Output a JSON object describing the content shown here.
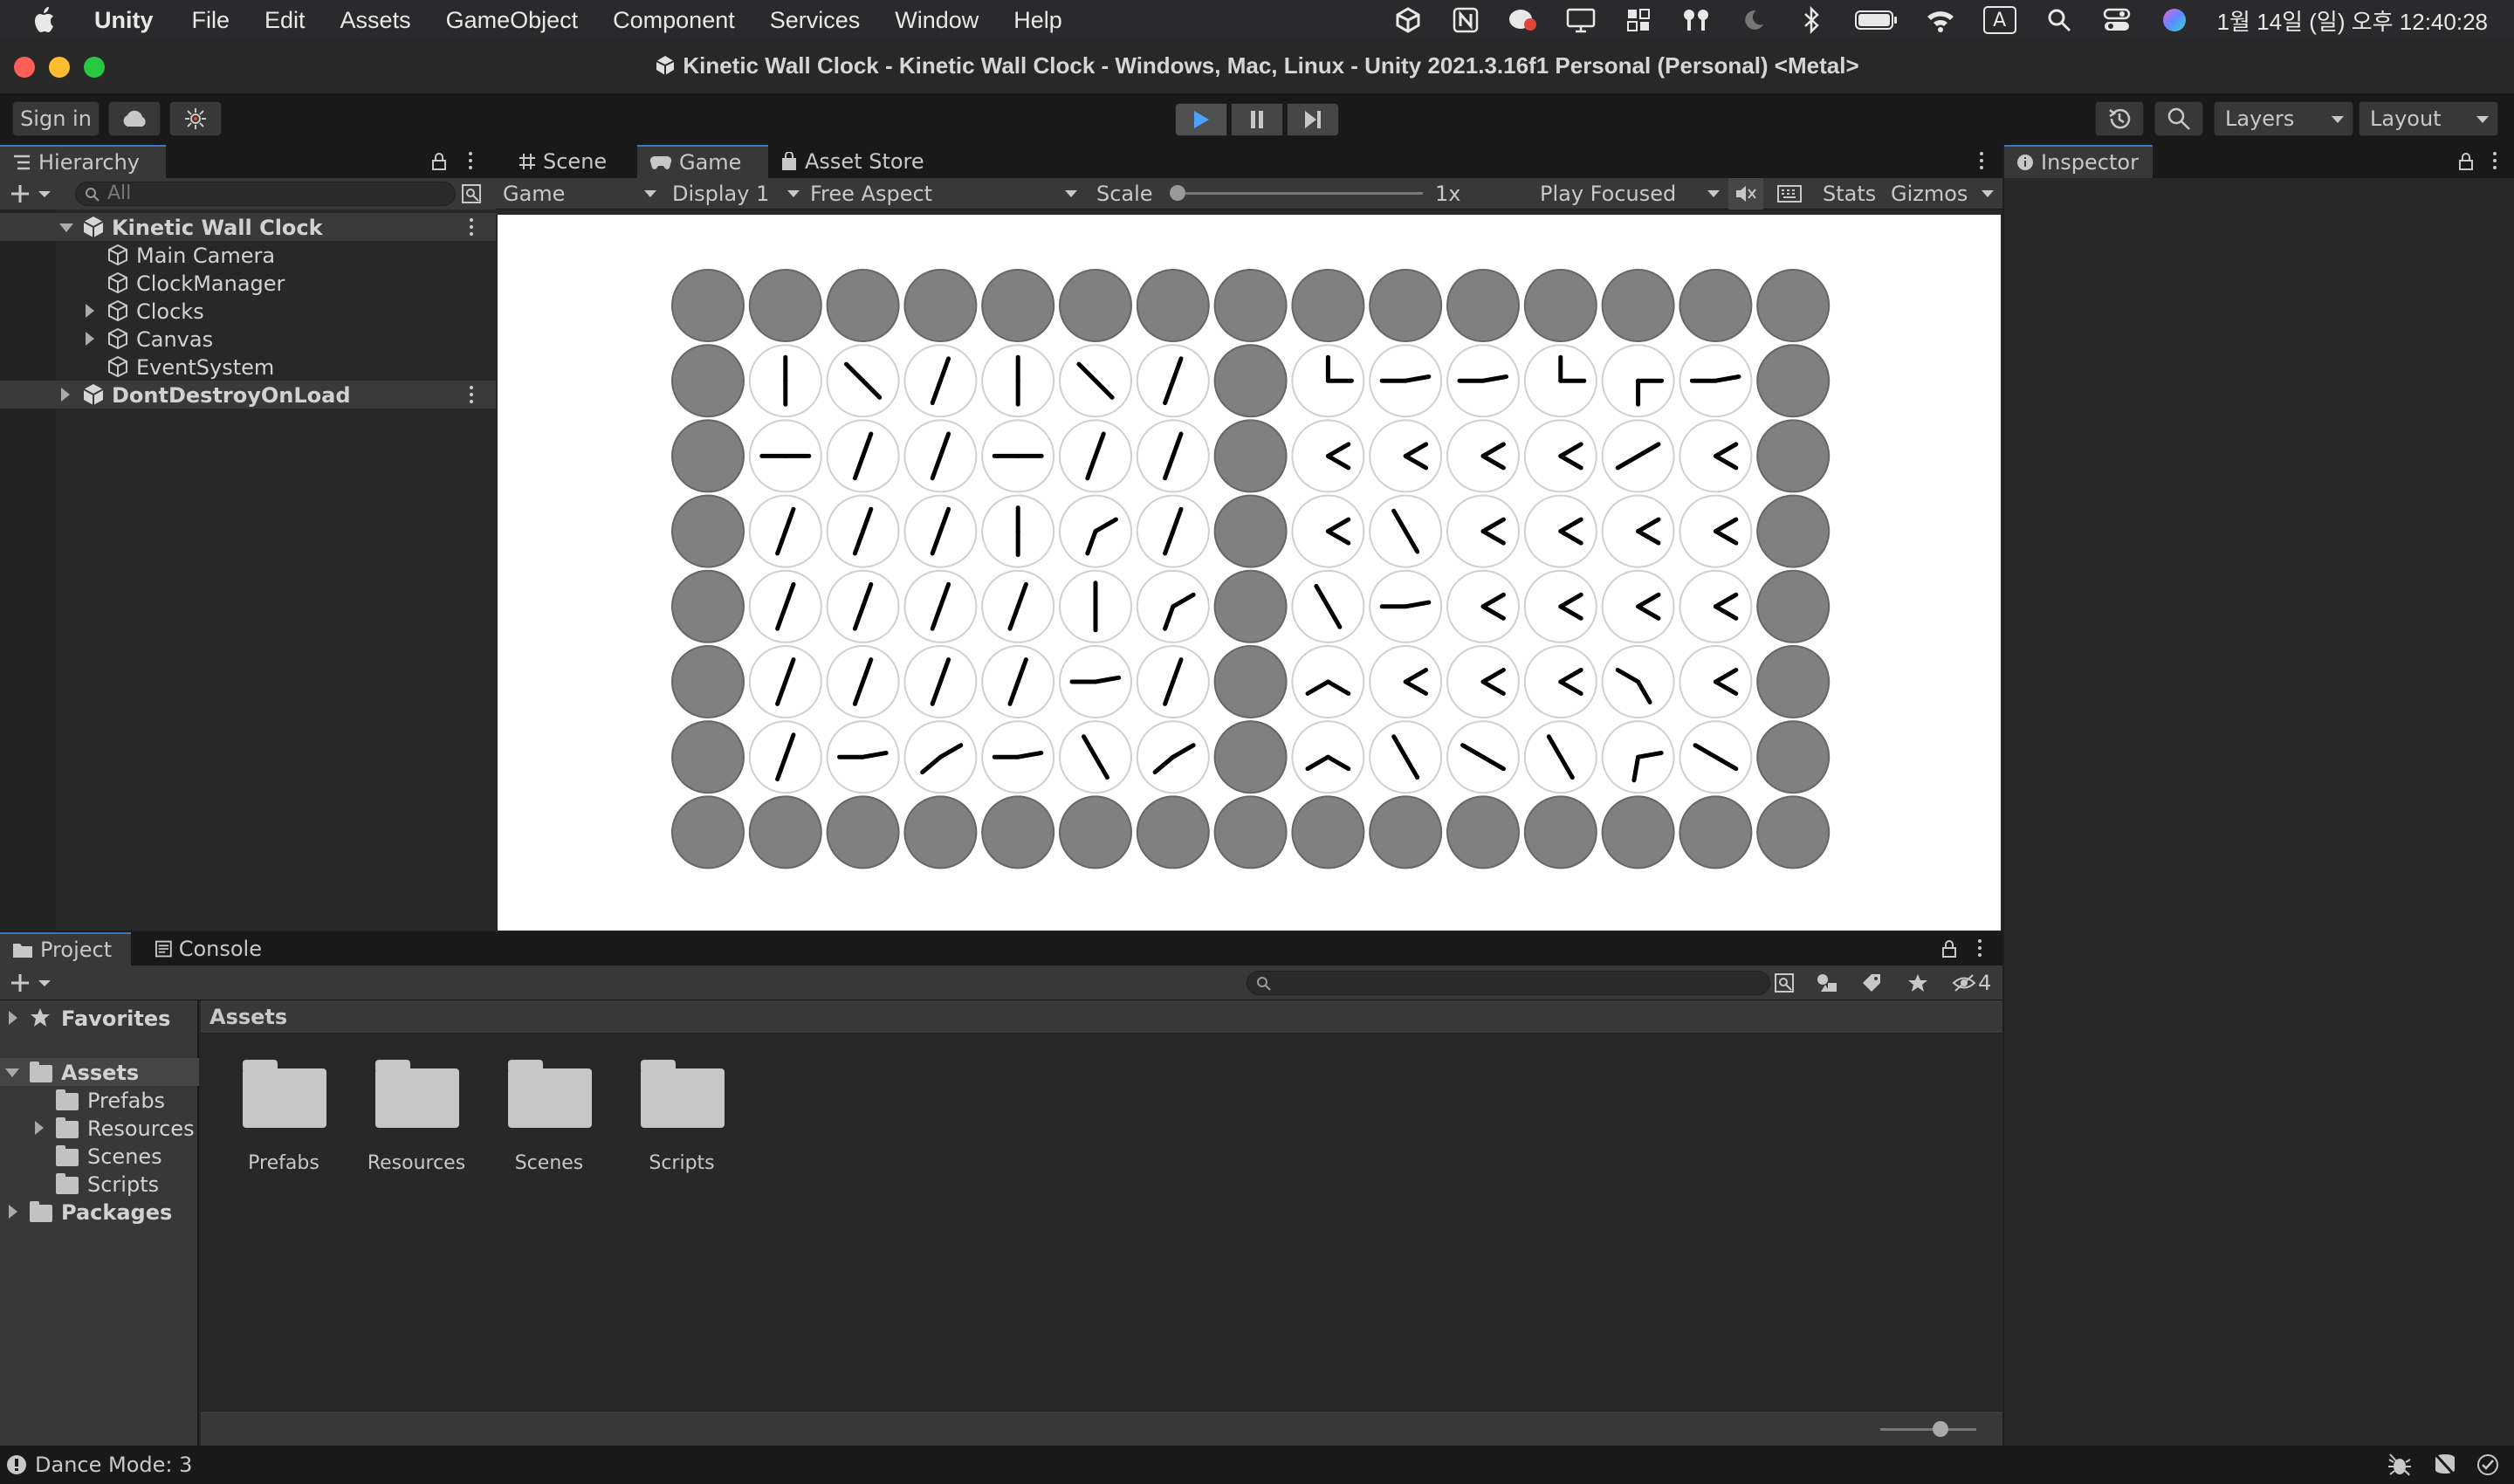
{
  "menubar": {
    "app_name": "Unity",
    "items": [
      "File",
      "Edit",
      "Assets",
      "GameObject",
      "Component",
      "Services",
      "Window",
      "Help"
    ],
    "input_source": "A",
    "clock": "1월 14일 (일) 오후 12:40:28"
  },
  "window": {
    "title": "Kinetic Wall Clock - Kinetic Wall Clock - Windows, Mac, Linux - Unity 2021.3.16f1 Personal (Personal) <Metal>"
  },
  "toolbar": {
    "sign_in": "Sign in",
    "layers": "Layers",
    "layout": "Layout"
  },
  "hierarchy": {
    "tab_label": "Hierarchy",
    "search_placeholder": "All",
    "rows": [
      {
        "label": "Kinetic Wall Clock",
        "level": 0,
        "scene": true,
        "expanded": true
      },
      {
        "label": "Main Camera",
        "level": 1
      },
      {
        "label": "ClockManager",
        "level": 1
      },
      {
        "label": "Clocks",
        "level": 1,
        "foldout": true
      },
      {
        "label": "Canvas",
        "level": 1,
        "foldout": true
      },
      {
        "label": "EventSystem",
        "level": 1
      },
      {
        "label": "DontDestroyOnLoad",
        "level": 0,
        "scene": true,
        "expanded": false
      }
    ]
  },
  "center_tabs": {
    "scene": "Scene",
    "game": "Game",
    "asset_store": "Asset Store"
  },
  "game_bar": {
    "view_mode": "Game",
    "display": "Display 1",
    "aspect": "Free Aspect",
    "scale_label": "Scale",
    "scale_value": "1x",
    "play_mode": "Play Focused",
    "stats": "Stats",
    "gizmos": "Gizmos"
  },
  "clock_grid": {
    "columns": 15,
    "rows": 8,
    "inactive_color": "#808080",
    "active_face_color": "#ffffff",
    "hand_color": "#000000",
    "hands_deg": [
      [
        null,
        null,
        null,
        null,
        null,
        null,
        null,
        null,
        null,
        null,
        null,
        null,
        null,
        null,
        null
      ],
      [
        null,
        [
          0,
          180
        ],
        [
          315,
          135
        ],
        [
          20,
          200
        ],
        [
          0,
          180
        ],
        [
          315,
          135
        ],
        [
          20,
          200
        ],
        null,
        [
          0,
          90
        ],
        [
          80,
          270
        ],
        [
          80,
          270
        ],
        [
          0,
          90
        ],
        [
          180,
          90
        ],
        [
          80,
          270
        ],
        null
      ],
      [
        null,
        [
          90,
          270
        ],
        [
          20,
          200
        ],
        [
          20,
          200
        ],
        [
          90,
          270
        ],
        [
          20,
          200
        ],
        [
          20,
          200
        ],
        null,
        [
          60,
          120
        ],
        [
          60,
          120
        ],
        [
          60,
          120
        ],
        [
          60,
          120
        ],
        [
          60,
          240
        ],
        [
          60,
          120
        ],
        null
      ],
      [
        null,
        [
          20,
          200
        ],
        [
          20,
          200
        ],
        [
          20,
          200
        ],
        [
          0,
          180
        ],
        [
          60,
          200
        ],
        [
          20,
          200
        ],
        null,
        [
          60,
          120
        ],
        [
          330,
          150
        ],
        [
          60,
          120
        ],
        [
          60,
          120
        ],
        [
          60,
          120
        ],
        [
          60,
          120
        ],
        null
      ],
      [
        null,
        [
          20,
          200
        ],
        [
          20,
          200
        ],
        [
          20,
          200
        ],
        [
          20,
          200
        ],
        [
          0,
          180
        ],
        [
          60,
          200
        ],
        null,
        [
          330,
          150
        ],
        [
          80,
          270
        ],
        [
          60,
          120
        ],
        [
          60,
          120
        ],
        [
          60,
          120
        ],
        [
          60,
          120
        ],
        null
      ],
      [
        null,
        [
          20,
          200
        ],
        [
          20,
          200
        ],
        [
          20,
          200
        ],
        [
          20,
          200
        ],
        [
          80,
          270
        ],
        [
          20,
          200
        ],
        null,
        [
          120,
          240
        ],
        [
          60,
          120
        ],
        [
          60,
          120
        ],
        [
          60,
          120
        ],
        [
          300,
          150
        ],
        [
          60,
          120
        ],
        null
      ],
      [
        null,
        [
          20,
          200
        ],
        [
          80,
          270
        ],
        [
          60,
          230
        ],
        [
          80,
          270
        ],
        [
          330,
          150
        ],
        [
          60,
          230
        ],
        null,
        [
          120,
          240
        ],
        [
          330,
          150
        ],
        [
          300,
          120
        ],
        [
          330,
          150
        ],
        [
          190,
          80
        ],
        [
          300,
          120
        ],
        null
      ],
      [
        null,
        null,
        null,
        null,
        null,
        null,
        null,
        null,
        null,
        null,
        null,
        null,
        null,
        null,
        null
      ]
    ]
  },
  "inspector": {
    "tab_label": "Inspector"
  },
  "project": {
    "tab_project": "Project",
    "tab_console": "Console",
    "hidden_count": "4",
    "breadcrumb": "Assets",
    "tree": [
      {
        "label": "Favorites",
        "level": 0,
        "bold": true
      },
      {
        "label": "Assets",
        "level": 0,
        "bold": true,
        "selected": true
      },
      {
        "label": "Prefabs",
        "level": 1
      },
      {
        "label": "Resources",
        "level": 1,
        "foldout": true
      },
      {
        "label": "Scenes",
        "level": 1
      },
      {
        "label": "Scripts",
        "level": 1
      },
      {
        "label": "Packages",
        "level": 0,
        "bold": true
      }
    ],
    "assets": [
      "Prefabs",
      "Resources",
      "Scenes",
      "Scripts"
    ]
  },
  "status": {
    "message": "Dance Mode: 3"
  }
}
